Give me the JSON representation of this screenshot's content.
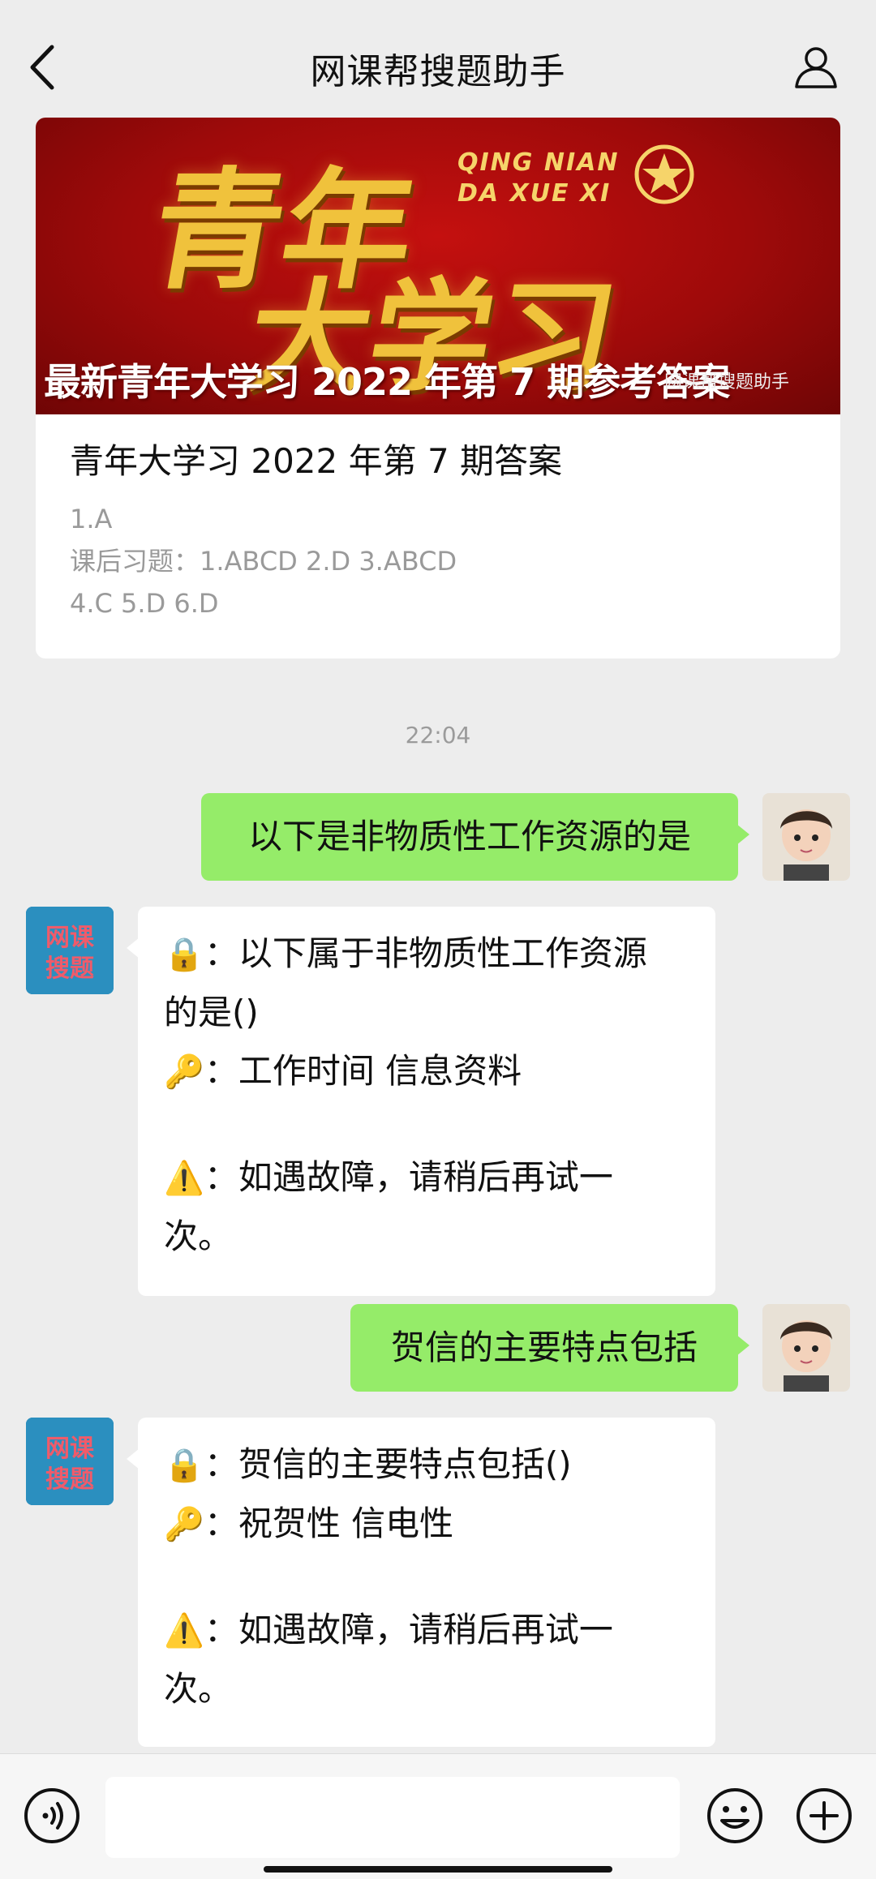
{
  "header": {
    "title": "网课帮搜题助手",
    "back_icon": "chevron-left-icon",
    "profile_icon": "person-icon"
  },
  "article": {
    "banner": {
      "big_line1": "青年",
      "big_line2": "大学习",
      "pinyin_line1": "QING NIAN",
      "pinyin_line2": "DA XUE XI",
      "subtitle": "最新青年大学习 2022 年第 7 期参考答案",
      "watermark": "网课帮搜题助手",
      "colors": {
        "background": "#b00c0c",
        "text_gold": "#f0c23c"
      }
    },
    "title": "青年大学习 2022 年第 7 期答案",
    "lines": [
      "1.A",
      "课后习题：1.ABCD 2.D 3.ABCD",
      "4.C 5.D 6.D"
    ]
  },
  "chat": {
    "timestamp": "22:04",
    "messages": [
      {
        "side": "out",
        "text": "以下是非物质性工作资源的是"
      },
      {
        "side": "in",
        "lines": [
          {
            "emoji": "🔒",
            "text": "：以下属于非物质性工作资源"
          },
          {
            "emoji": "",
            "text": "的是()"
          },
          {
            "emoji": "🔑",
            "text": "：工作时间 信息资料"
          },
          {
            "emoji": "",
            "text": ""
          },
          {
            "emoji": "⚠️",
            "text": "：如遇故障，请稍后再试一"
          },
          {
            "emoji": "",
            "text": "次。"
          }
        ]
      },
      {
        "side": "out",
        "text": "贺信的主要特点包括"
      },
      {
        "side": "in",
        "lines": [
          {
            "emoji": "🔒",
            "text": "：贺信的主要特点包括()"
          },
          {
            "emoji": "🔑",
            "text": "：祝贺性 信电性"
          },
          {
            "emoji": "",
            "text": ""
          },
          {
            "emoji": "⚠️",
            "text": "：如遇故障，请稍后再试一"
          },
          {
            "emoji": "",
            "text": "次。"
          }
        ]
      }
    ],
    "bot_avatar_text": "网课搜题"
  },
  "input_bar": {
    "voice_icon": "voice-icon",
    "emoji_icon": "smiley-icon",
    "plus_icon": "plus-icon",
    "input_value": ""
  },
  "colors": {
    "background": "#ededed",
    "outgoing_bubble": "#95ec69",
    "incoming_bubble": "#ffffff"
  }
}
